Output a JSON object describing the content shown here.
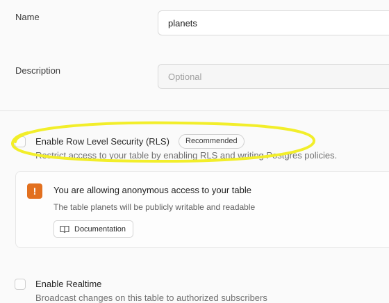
{
  "form": {
    "name_label": "Name",
    "name_value": "planets",
    "description_label": "Description",
    "description_placeholder": "Optional"
  },
  "rls": {
    "label": "Enable Row Level Security (RLS)",
    "badge": "Recommended",
    "description": "Restrict access to your table by enabling RLS and writing Postgres policies."
  },
  "alert": {
    "icon": "warning-icon",
    "title": "You are allowing anonymous access to your table",
    "description": "The table planets will be publicly writable and readable",
    "button_label": "Documentation",
    "button_icon": "book-icon"
  },
  "realtime": {
    "label": "Enable Realtime",
    "description": "Broadcast changes on this table to authorized subscribers"
  },
  "colors": {
    "warning": "#e2701f",
    "annotation": "#f2ee2a"
  }
}
